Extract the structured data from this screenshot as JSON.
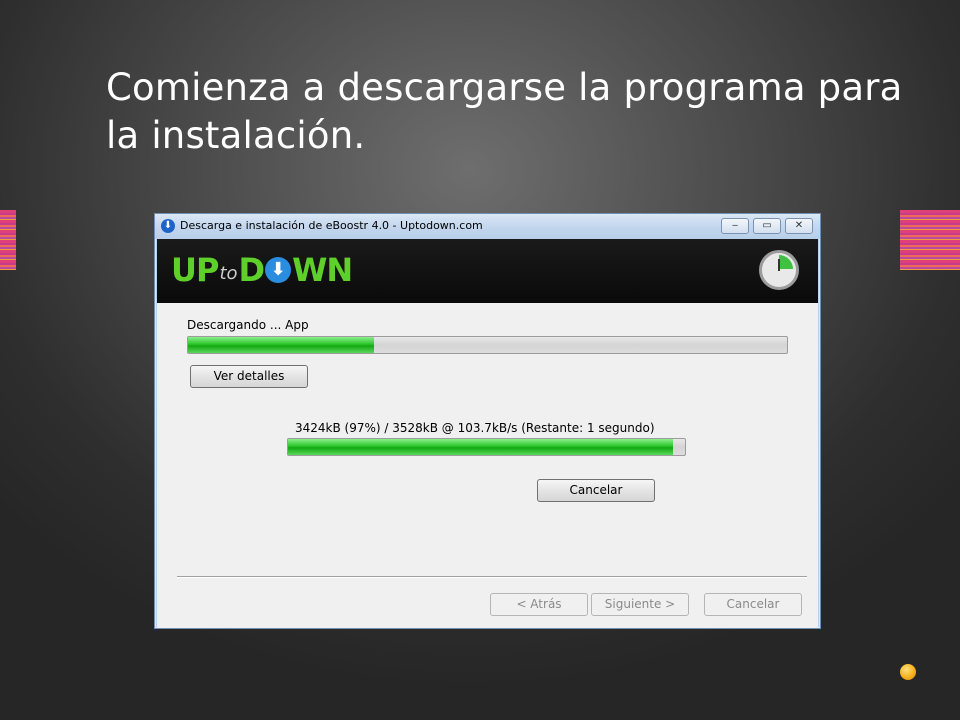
{
  "slide": {
    "title": "Comienza a descargarse la programa para la instalación."
  },
  "window": {
    "title": "Descarga e instalación de eBoostr 4.0 - Uptodown.com",
    "controls": {
      "minimize": "‒",
      "maximize": "▭",
      "close": "✕"
    }
  },
  "banner": {
    "logo": {
      "up": "UP",
      "to": "to",
      "arrow": "⬇",
      "down": "WN",
      "d": "D"
    }
  },
  "download": {
    "status_label": "Descargando ... App",
    "overall_progress": 0.31,
    "details_button": "Ver detalles",
    "file_status": "3424kB (97%) / 3528kB @ 103.7kB/s (Restante: 1 segundo)",
    "file_progress": 0.97,
    "cancel_button": "Cancelar"
  },
  "footer": {
    "back_button": "< Atrás",
    "next_button": "Siguiente >",
    "cancel_button": "Cancelar"
  },
  "colors": {
    "progress_green": "#2cc52c",
    "logo_green": "#5fcf2a",
    "logo_blue": "#2a8de0",
    "accent_orange": "#f6b01e"
  }
}
